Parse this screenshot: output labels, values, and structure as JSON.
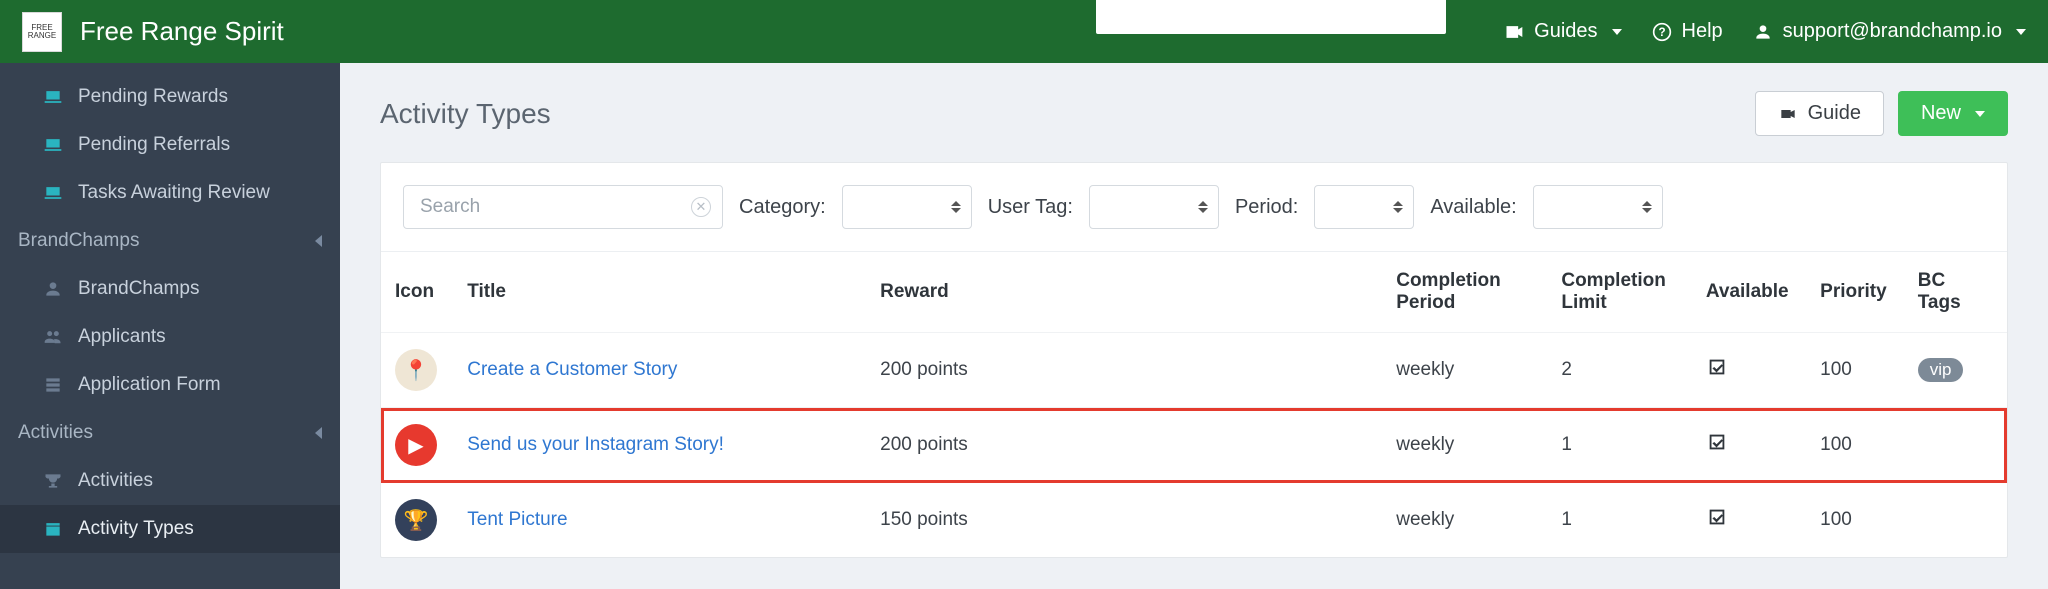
{
  "topbar": {
    "brand": "Free Range Spirit",
    "guides": "Guides",
    "help": "Help",
    "support": "support@brandchamp.io"
  },
  "sidebar": {
    "items": [
      {
        "label": "Pending Rewards"
      },
      {
        "label": "Pending Referrals"
      },
      {
        "label": "Tasks Awaiting Review"
      }
    ],
    "section_brandchamps": "BrandChamps",
    "brandchamps_items": [
      {
        "label": "BrandChamps"
      },
      {
        "label": "Applicants"
      },
      {
        "label": "Application Form"
      }
    ],
    "section_activities": "Activities",
    "activities_items": [
      {
        "label": "Activities"
      },
      {
        "label": "Activity Types"
      }
    ]
  },
  "page": {
    "title": "Activity Types",
    "guide_btn": "Guide",
    "new_btn": "New"
  },
  "filters": {
    "search_placeholder": "Search",
    "category_label": "Category:",
    "usertag_label": "User Tag:",
    "period_label": "Period:",
    "available_label": "Available:"
  },
  "table": {
    "headers": {
      "icon": "Icon",
      "title": "Title",
      "reward": "Reward",
      "completion_period": "Completion Period",
      "completion_limit": "Completion Limit",
      "available": "Available",
      "priority": "Priority",
      "bc_tags": "BC Tags"
    },
    "rows": [
      {
        "title": "Create a Customer Story",
        "reward": "200 points",
        "completion_period": "weekly",
        "completion_limit": "2",
        "available": true,
        "priority": "100",
        "tag": "vip",
        "highlight": false,
        "icon": "pin"
      },
      {
        "title": "Send us your Instagram Story!",
        "reward": "200 points",
        "completion_period": "weekly",
        "completion_limit": "1",
        "available": true,
        "priority": "100",
        "tag": "",
        "highlight": true,
        "icon": "video"
      },
      {
        "title": "Tent Picture",
        "reward": "150 points",
        "completion_period": "weekly",
        "completion_limit": "1",
        "available": true,
        "priority": "100",
        "tag": "",
        "highlight": false,
        "icon": "trophy"
      }
    ]
  }
}
